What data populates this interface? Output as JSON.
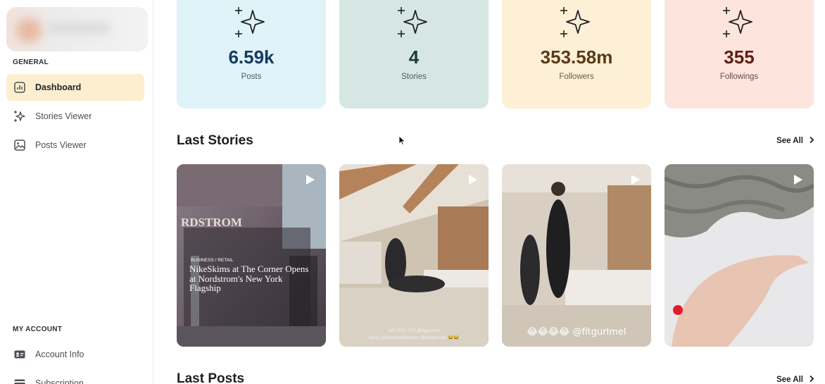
{
  "sidebar": {
    "general_label": "GENERAL",
    "account_label": "MY ACCOUNT",
    "items": [
      {
        "label": "Dashboard",
        "icon": "bar-chart-icon",
        "active": true
      },
      {
        "label": "Stories Viewer",
        "icon": "sparkle-icon",
        "active": false
      },
      {
        "label": "Posts Viewer",
        "icon": "image-icon",
        "active": false
      }
    ],
    "account_items": [
      {
        "label": "Account Info",
        "icon": "id-card-icon"
      },
      {
        "label": "Subscription",
        "icon": "card-icon"
      }
    ]
  },
  "stats": [
    {
      "value": "6.59k",
      "label": "Posts",
      "bg": "#dff3f8",
      "value_color": "#173a5e",
      "label_color": "#4b5a66"
    },
    {
      "value": "4",
      "label": "Stories",
      "bg": "#d6e7e3",
      "value_color": "#1d3a3a",
      "label_color": "#4e5b5c"
    },
    {
      "value": "353.58m",
      "label": "Followers",
      "bg": "#fdf0d6",
      "value_color": "#5a3a1a",
      "label_color": "#6b5c48"
    },
    {
      "value": "355",
      "label": "Followings",
      "bg": "#fde4dd",
      "value_color": "#5c1f14",
      "label_color": "#6a4b45"
    }
  ],
  "last_stories": {
    "title": "Last Stories",
    "see_all": "See All",
    "items": [
      {
        "overlay_kicker": "BUSINESS / RETAIL",
        "overlay_headline": "NikeSkims at The Corner Opens at Nordstrom's New York Flagship",
        "storefront_text": "RDSTROM"
      },
      {
        "caption_line1": "WE GOT IT!!! @fitgurlmel",
        "caption_line2": "Sorry @khloekardashian @kyliejenner 😂😂"
      },
      {
        "caption": "😂😂😂😂 @fitgurlmel"
      },
      {}
    ]
  },
  "last_posts": {
    "title": "Last Posts",
    "see_all": "See All"
  },
  "colors": {
    "active_nav_bg": "#fdeed0",
    "play_icon": "#ffffff"
  }
}
